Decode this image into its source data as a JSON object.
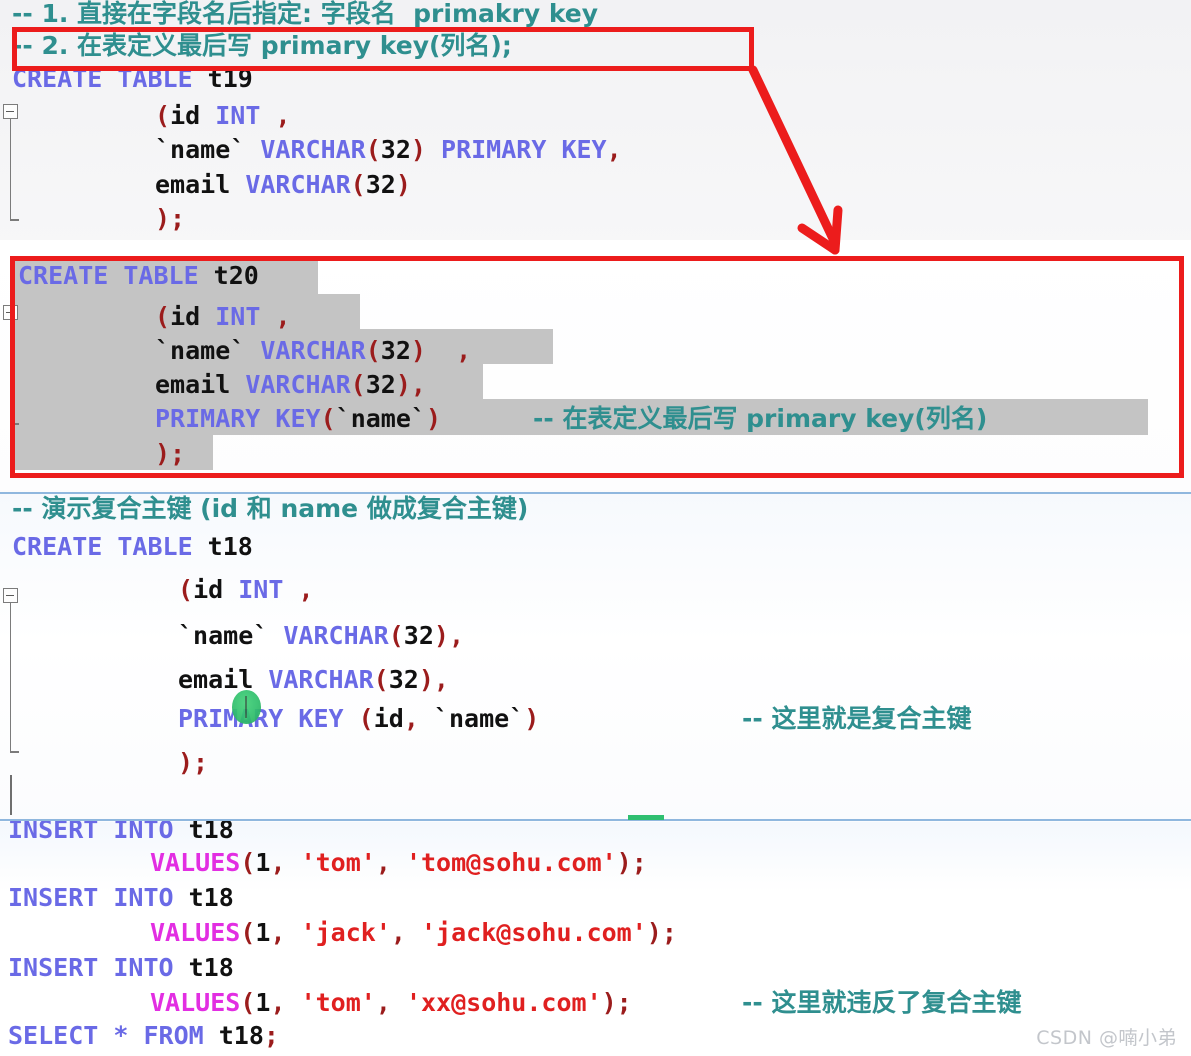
{
  "editor": {
    "colors": {
      "keyword": "#6a6ae6",
      "comment": "#2f8f8f",
      "punctuation": "#9b1c1c",
      "string": "#e02020",
      "values_keyword": "#e22ee2",
      "selection": "#c4c4c4",
      "annotation_red": "#ec1c1c",
      "rule_blue": "#8fb7de",
      "cursor_green": "#2fbf6b",
      "watermark": "#c3c6cb"
    },
    "blocks": [
      {
        "id": "block-t19",
        "lines": [
          {
            "id": "l1",
            "indent": 0,
            "tokens": [
              {
                "t": "-- 1. 直接在字段名后指定: 字段名  primakry key",
                "c": "cmt",
                "cjk": true
              }
            ]
          },
          {
            "id": "l2",
            "indent": 0,
            "tokens": [
              {
                "t": "-- 2. 在表定义最后写 primary key(列名);",
                "c": "cmt",
                "cjk": true
              }
            ]
          },
          {
            "id": "l3",
            "indent": 0,
            "tokens": [
              {
                "t": "CREATE TABLE ",
                "c": "kw"
              },
              {
                "t": "t19",
                "c": "ident"
              }
            ]
          },
          {
            "id": "l4",
            "indent": 1,
            "tokens": [
              {
                "t": "(",
                "c": "punc"
              },
              {
                "t": "id ",
                "c": "ident"
              },
              {
                "t": "INT",
                "c": "kw"
              },
              {
                "t": " ",
                "c": "ident"
              },
              {
                "t": ",",
                "c": "punc"
              }
            ]
          },
          {
            "id": "l5",
            "indent": 1,
            "tokens": [
              {
                "t": "`name`",
                "c": "ident"
              },
              {
                "t": " ",
                "c": "ident"
              },
              {
                "t": "VARCHAR",
                "c": "kw"
              },
              {
                "t": "(",
                "c": "punc"
              },
              {
                "t": "32",
                "c": "num"
              },
              {
                "t": ")",
                "c": "punc"
              },
              {
                "t": " ",
                "c": "ident"
              },
              {
                "t": "PRIMARY KEY",
                "c": "kw"
              },
              {
                "t": ",",
                "c": "punc"
              }
            ]
          },
          {
            "id": "l6",
            "indent": 1,
            "tokens": [
              {
                "t": "email ",
                "c": "ident"
              },
              {
                "t": "VARCHAR",
                "c": "kw"
              },
              {
                "t": "(",
                "c": "punc"
              },
              {
                "t": "32",
                "c": "num"
              },
              {
                "t": ")",
                "c": "punc"
              }
            ]
          },
          {
            "id": "l7",
            "indent": 1,
            "tokens": [
              {
                "t": ");",
                "c": "punc"
              }
            ]
          }
        ]
      },
      {
        "id": "block-t20",
        "lines": [
          {
            "id": "l8",
            "indent": 0,
            "tokens": [
              {
                "t": "CREATE TABLE ",
                "c": "kw"
              },
              {
                "t": "t20",
                "c": "ident"
              }
            ]
          },
          {
            "id": "l9",
            "indent": 1,
            "tokens": [
              {
                "t": "(",
                "c": "punc"
              },
              {
                "t": "id ",
                "c": "ident"
              },
              {
                "t": "INT",
                "c": "kw"
              },
              {
                "t": " ",
                "c": "ident"
              },
              {
                "t": ",",
                "c": "punc"
              }
            ]
          },
          {
            "id": "l10",
            "indent": 1,
            "tokens": [
              {
                "t": "`name`",
                "c": "ident"
              },
              {
                "t": " ",
                "c": "ident"
              },
              {
                "t": "VARCHAR",
                "c": "kw"
              },
              {
                "t": "(",
                "c": "punc"
              },
              {
                "t": "32",
                "c": "num"
              },
              {
                "t": ")",
                "c": "punc"
              },
              {
                "t": "  ",
                "c": "ident"
              },
              {
                "t": ",",
                "c": "punc"
              }
            ]
          },
          {
            "id": "l11",
            "indent": 1,
            "tokens": [
              {
                "t": "email ",
                "c": "ident"
              },
              {
                "t": "VARCHAR",
                "c": "kw"
              },
              {
                "t": "(",
                "c": "punc"
              },
              {
                "t": "32",
                "c": "num"
              },
              {
                "t": ")",
                "c": "punc"
              },
              {
                "t": ",",
                "c": "punc"
              }
            ]
          },
          {
            "id": "l12",
            "indent": 1,
            "tokens": [
              {
                "t": "PRIMARY KEY",
                "c": "kw"
              },
              {
                "t": "(",
                "c": "punc"
              },
              {
                "t": "`name`",
                "c": "ident"
              },
              {
                "t": ")",
                "c": "punc"
              }
            ]
          },
          {
            "id": "l12c",
            "indent": 0,
            "tokens": [
              {
                "t": "-- 在表定义最后写 primary key(列名)",
                "c": "cmt",
                "cjk": true
              }
            ]
          },
          {
            "id": "l13",
            "indent": 1,
            "tokens": [
              {
                "t": ");",
                "c": "punc"
              }
            ]
          }
        ]
      },
      {
        "id": "block-t18",
        "lines": [
          {
            "id": "l14",
            "indent": 0,
            "tokens": [
              {
                "t": "-- 演示复合主键 (id 和 name 做成复合主键)",
                "c": "cmt",
                "cjk": true
              }
            ]
          },
          {
            "id": "l15",
            "indent": 0,
            "tokens": [
              {
                "t": "CREATE TABLE ",
                "c": "kw"
              },
              {
                "t": "t18",
                "c": "ident"
              }
            ]
          },
          {
            "id": "l16",
            "indent": 1,
            "tokens": [
              {
                "t": "(",
                "c": "punc"
              },
              {
                "t": "id ",
                "c": "ident"
              },
              {
                "t": "INT",
                "c": "kw"
              },
              {
                "t": " ",
                "c": "ident"
              },
              {
                "t": ",",
                "c": "punc"
              }
            ]
          },
          {
            "id": "l17",
            "indent": 1,
            "tokens": [
              {
                "t": "`name`",
                "c": "ident"
              },
              {
                "t": " ",
                "c": "ident"
              },
              {
                "t": "VARCHAR",
                "c": "kw"
              },
              {
                "t": "(",
                "c": "punc"
              },
              {
                "t": "32",
                "c": "num"
              },
              {
                "t": ")",
                "c": "punc"
              },
              {
                "t": ",",
                "c": "punc"
              }
            ]
          },
          {
            "id": "l18",
            "indent": 1,
            "tokens": [
              {
                "t": "email ",
                "c": "ident"
              },
              {
                "t": "VARCHAR",
                "c": "kw"
              },
              {
                "t": "(",
                "c": "punc"
              },
              {
                "t": "32",
                "c": "num"
              },
              {
                "t": ")",
                "c": "punc"
              },
              {
                "t": ",",
                "c": "punc"
              }
            ]
          },
          {
            "id": "l19",
            "indent": 1,
            "tokens": [
              {
                "t": "PRIMARY KEY",
                "c": "kw"
              },
              {
                "t": " ",
                "c": "ident"
              },
              {
                "t": "(",
                "c": "punc"
              },
              {
                "t": "id",
                "c": "ident"
              },
              {
                "t": ",",
                "c": "punc"
              },
              {
                "t": " `name`",
                "c": "ident"
              },
              {
                "t": ")",
                "c": "punc"
              }
            ]
          },
          {
            "id": "l19c",
            "indent": 0,
            "tokens": [
              {
                "t": "-- 这里就是复合主键",
                "c": "cmt",
                "cjk": true
              }
            ]
          },
          {
            "id": "l20",
            "indent": 1,
            "tokens": [
              {
                "t": ");",
                "c": "punc"
              }
            ]
          }
        ]
      },
      {
        "id": "block-inserts",
        "lines": [
          {
            "id": "l21",
            "indent": 0,
            "tokens": [
              {
                "t": "INSERT INTO ",
                "c": "kw"
              },
              {
                "t": "t18",
                "c": "ident"
              }
            ]
          },
          {
            "id": "l22",
            "indent": 1,
            "tokens": [
              {
                "t": "VALUES",
                "c": "vals"
              },
              {
                "t": "(",
                "c": "punc"
              },
              {
                "t": "1",
                "c": "num"
              },
              {
                "t": ",",
                "c": "punc"
              },
              {
                "t": " ",
                "c": "ident"
              },
              {
                "t": "'tom'",
                "c": "str"
              },
              {
                "t": ",",
                "c": "punc"
              },
              {
                "t": " ",
                "c": "ident"
              },
              {
                "t": "'tom@sohu.com'",
                "c": "str"
              },
              {
                "t": ");",
                "c": "punc"
              }
            ]
          },
          {
            "id": "l23",
            "indent": 0,
            "tokens": [
              {
                "t": "INSERT INTO ",
                "c": "kw"
              },
              {
                "t": "t18",
                "c": "ident"
              }
            ]
          },
          {
            "id": "l24",
            "indent": 1,
            "tokens": [
              {
                "t": "VALUES",
                "c": "vals"
              },
              {
                "t": "(",
                "c": "punc"
              },
              {
                "t": "1",
                "c": "num"
              },
              {
                "t": ",",
                "c": "punc"
              },
              {
                "t": " ",
                "c": "ident"
              },
              {
                "t": "'jack'",
                "c": "str"
              },
              {
                "t": ",",
                "c": "punc"
              },
              {
                "t": " ",
                "c": "ident"
              },
              {
                "t": "'jack@sohu.com'",
                "c": "str"
              },
              {
                "t": ");",
                "c": "punc"
              }
            ]
          },
          {
            "id": "l25",
            "indent": 0,
            "tokens": [
              {
                "t": "INSERT INTO ",
                "c": "kw"
              },
              {
                "t": "t18",
                "c": "ident"
              }
            ]
          },
          {
            "id": "l26",
            "indent": 1,
            "tokens": [
              {
                "t": "VALUES",
                "c": "vals"
              },
              {
                "t": "(",
                "c": "punc"
              },
              {
                "t": "1",
                "c": "num"
              },
              {
                "t": ",",
                "c": "punc"
              },
              {
                "t": " ",
                "c": "ident"
              },
              {
                "t": "'tom'",
                "c": "str"
              },
              {
                "t": ",",
                "c": "punc"
              },
              {
                "t": " ",
                "c": "ident"
              },
              {
                "t": "'xx@sohu.com'",
                "c": "str"
              },
              {
                "t": ");",
                "c": "punc"
              }
            ]
          },
          {
            "id": "l26c",
            "indent": 0,
            "tokens": [
              {
                "t": "-- 这里就违反了复合主键",
                "c": "cmt",
                "cjk": true
              }
            ]
          },
          {
            "id": "l27",
            "indent": 0,
            "tokens": [
              {
                "t": "SELECT ",
                "c": "kw"
              },
              {
                "t": "*",
                "c": "star"
              },
              {
                "t": " FROM ",
                "c": "kw"
              },
              {
                "t": "t18",
                "c": "ident"
              },
              {
                "t": ";",
                "c": "punc"
              }
            ]
          }
        ]
      }
    ],
    "annotations": {
      "redbox_1_label": "highlight-rule-2",
      "redbox_2_label": "highlight-t20-statement",
      "arrow_label": "points-from-rule-2-to-t20"
    },
    "watermark": "CSDN @喃小弟"
  }
}
